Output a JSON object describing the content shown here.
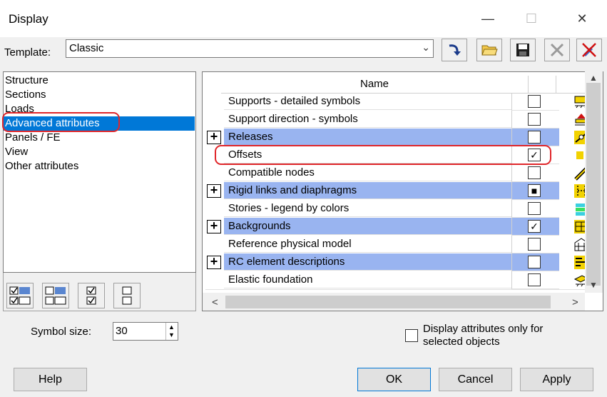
{
  "window": {
    "title": "Display",
    "minimize": "—",
    "maximize": "☐",
    "close": "✕"
  },
  "template": {
    "label": "Template:",
    "value": "Classic"
  },
  "toolbar_icons": [
    "apply-arrow-icon",
    "open-folder-icon",
    "save-disk-icon",
    "delete-x-icon",
    "crossed-pencil-icon"
  ],
  "left_list": {
    "items": [
      "Structure",
      "Sections",
      "Loads",
      "Advanced attributes",
      "Panels / FE",
      "View",
      "Other attributes"
    ],
    "selected": "Advanced attributes"
  },
  "grid": {
    "header": "Name",
    "rows": [
      {
        "name": "Supports - detailed symbols",
        "group": false,
        "check": ""
      },
      {
        "name": "Support direction - symbols",
        "group": false,
        "check": ""
      },
      {
        "name": "Releases",
        "group": true,
        "check": ""
      },
      {
        "name": "Offsets",
        "group": false,
        "check": "✓"
      },
      {
        "name": "Compatible nodes",
        "group": false,
        "check": ""
      },
      {
        "name": "Rigid links and diaphragms",
        "group": true,
        "check": "■"
      },
      {
        "name": "Stories - legend by colors",
        "group": false,
        "check": ""
      },
      {
        "name": "Backgrounds",
        "group": true,
        "check": "✓"
      },
      {
        "name": "Reference physical model",
        "group": false,
        "check": ""
      },
      {
        "name": "RC element descriptions",
        "group": true,
        "check": ""
      },
      {
        "name": "Elastic foundation",
        "group": false,
        "check": ""
      }
    ],
    "expand_glyph": "+"
  },
  "symbol_size": {
    "label": "Symbol size:",
    "value": "30"
  },
  "display_only": {
    "label_line1": "Display attributes only for",
    "label_line2": "selected objects"
  },
  "buttons": {
    "help": "Help",
    "ok": "OK",
    "cancel": "Cancel",
    "apply": "Apply"
  },
  "scroll": {
    "up": "▲",
    "down": "▼",
    "left": "<",
    "right": ">"
  },
  "colors": {
    "selection": "#0078d7",
    "group_row": "#99b4f0",
    "annotation": "#e0262a"
  }
}
